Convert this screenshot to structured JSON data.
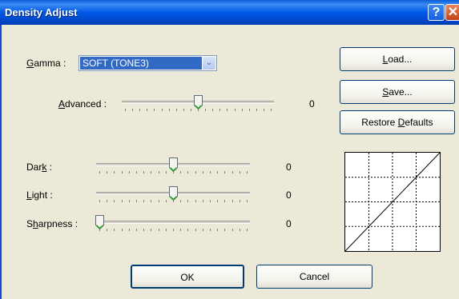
{
  "window": {
    "title": "Density Adjust",
    "help_glyph": "?",
    "close_glyph": "✕"
  },
  "gamma": {
    "label_accel": "G",
    "label_rest": "amma :",
    "selected": "SOFT (TONE3)",
    "dropdown_glyph": "⌄"
  },
  "advanced": {
    "label_accel": "A",
    "label_rest": "dvanced :",
    "value": "0",
    "level": 0.5
  },
  "dark": {
    "label_pre": "Dar",
    "label_accel": "k",
    "label_post": " :",
    "value": "0",
    "level": 0.5
  },
  "light": {
    "label_pre": "",
    "label_accel": "L",
    "label_post": "ight :",
    "value": "0",
    "level": 0.5
  },
  "sharpness": {
    "label_pre": "S",
    "label_accel": "h",
    "label_post": "arpness :",
    "value": "0",
    "level": 0.0
  },
  "buttons": {
    "load_accel": "L",
    "load_rest": "oad...",
    "save_accel": "S",
    "save_rest": "ave...",
    "restore_pre": "Restore ",
    "restore_accel": "D",
    "restore_post": "efaults",
    "ok": "OK",
    "cancel": "Cancel"
  },
  "colors": {
    "titlebar": "#0058e6",
    "selection": "#316ac5",
    "dialog_bg": "#ece9d8",
    "thumb_accent": "#21a121"
  }
}
